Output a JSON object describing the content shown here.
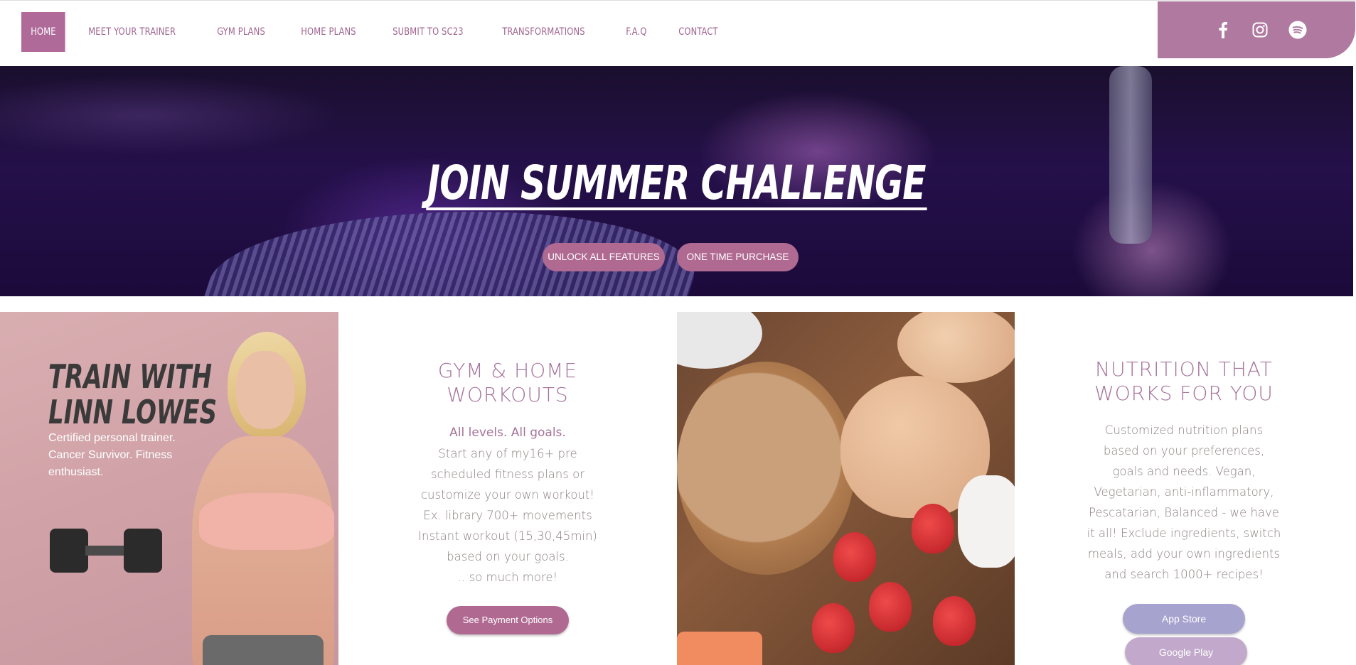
{
  "nav": {
    "items": [
      {
        "label": "HOME",
        "active": true
      },
      {
        "label": "MEET YOUR TRAINER"
      },
      {
        "label": "GYM PLANS"
      },
      {
        "label": "HOME PLANS"
      },
      {
        "label": "SUBMIT TO SC23"
      },
      {
        "label": "TRANSFORMATIONS"
      },
      {
        "label": "F.A.Q"
      },
      {
        "label": "CONTACT"
      }
    ]
  },
  "social": {
    "icons": [
      "facebook-icon",
      "instagram-icon",
      "spotify-icon"
    ],
    "bg_color": "#b07aa0"
  },
  "hero": {
    "title": "JOIN SUMMER CHALLENGE",
    "buttons": {
      "unlock": "UNLOCK ALL FEATURES",
      "purchase": "ONE TIME PURCHASE"
    }
  },
  "trainer": {
    "title_line1": "TRAIN WITH",
    "title_line2": "LINN LOWES",
    "subtitle": "Certified personal trainer. Cancer Survivor. Fitness enthusiast."
  },
  "workouts": {
    "title_line1": "GYM & HOME",
    "title_line2": "WORKOUTS",
    "lead": "All levels. All goals.",
    "lines": [
      "Start any of my16+ pre",
      "scheduled fitness plans or",
      "customize your own workout!",
      "Ex. library 700+ movements",
      "Instant workout (15,30,45min)",
      "based on your goals.",
      ".. so much more!"
    ],
    "button": "See Payment Options"
  },
  "nutrition": {
    "title_line1": "NUTRITION THAT",
    "title_line2": "WORKS FOR YOU",
    "lines": [
      "Customized nutrition plans",
      "based on your preferences,",
      "goals and needs. Vegan,",
      "Vegetarian, anti-inflammatory,",
      "Pescatarian, Balanced - we have",
      "it all! Exclude ingredients, switch",
      "meals, add your own ingredients",
      "and search 1000+ recipes!"
    ],
    "app_store": "App Store",
    "google_play": "Google Play"
  },
  "colors": {
    "accent": "#b06a92",
    "text_purple": "#a5739a",
    "app_store": "#a7a3cf",
    "google_play": "#c2a9cb"
  }
}
